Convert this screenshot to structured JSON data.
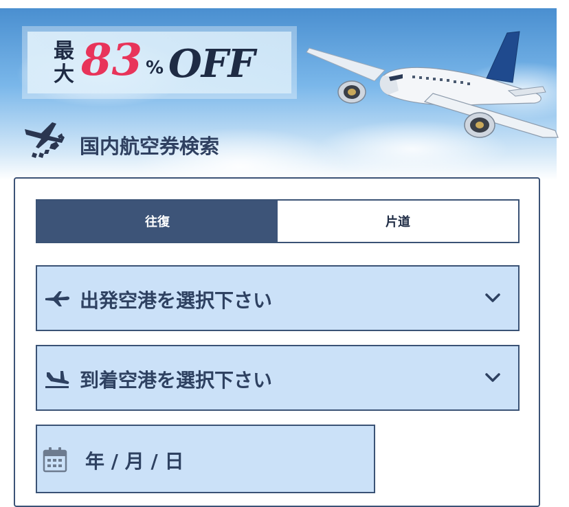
{
  "banner": {
    "max_label": "最大",
    "discount_number": "83",
    "percent_symbol": "%",
    "off_label": "OFF"
  },
  "section": {
    "title": "国内航空券検索"
  },
  "trip_type": {
    "tabs": [
      {
        "label": "往復",
        "active": true
      },
      {
        "label": "片道",
        "active": false
      }
    ]
  },
  "departure": {
    "placeholder": "出発空港を選択下さい"
  },
  "arrival": {
    "placeholder": "到着空港を選択下さい"
  },
  "date": {
    "placeholder": "年 / 月 / 日"
  },
  "colors": {
    "navy": "#3d5478",
    "field_bg": "#cbe1f8",
    "accent_pink": "#e8345a",
    "text_dark": "#2e4161"
  },
  "icons": {
    "section": "airplane-japan-map-icon",
    "departure": "airplane-takeoff-icon",
    "arrival": "airplane-landing-icon",
    "dropdown": "chevron-down-icon",
    "date": "calendar-icon"
  }
}
